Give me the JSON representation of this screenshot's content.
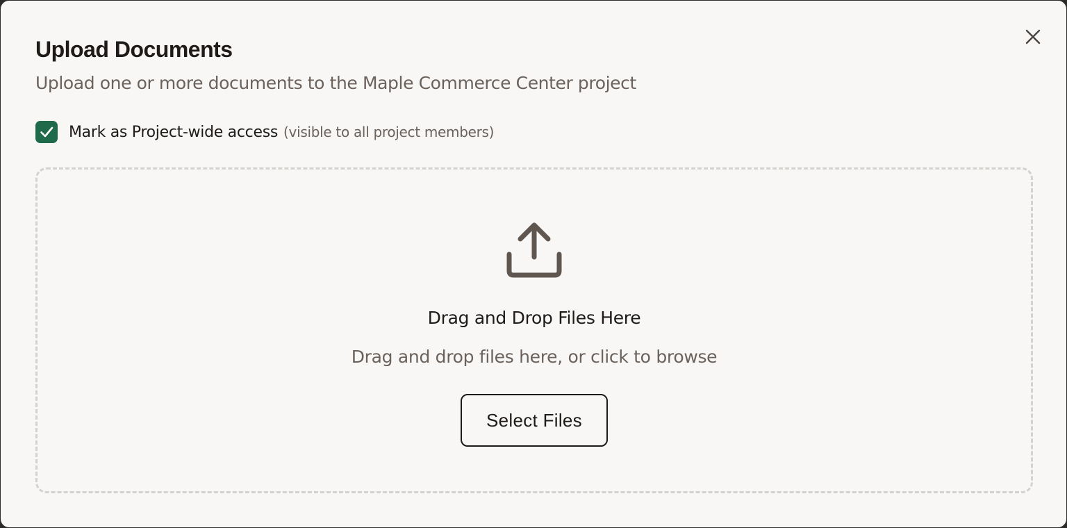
{
  "dialog": {
    "title": "Upload Documents",
    "subtitle": "Upload one or more documents to the Maple Commerce Center project",
    "close_icon": "close-icon"
  },
  "access": {
    "checked": true,
    "label": "Mark as Project-wide access",
    "hint": "(visible to all project members)",
    "accent_color": "#1f6a4a"
  },
  "dropzone": {
    "icon": "upload-icon",
    "title": "Drag and Drop Files Here",
    "hint": "Drag and drop files here, or click to browse",
    "button_label": "Select Files"
  }
}
